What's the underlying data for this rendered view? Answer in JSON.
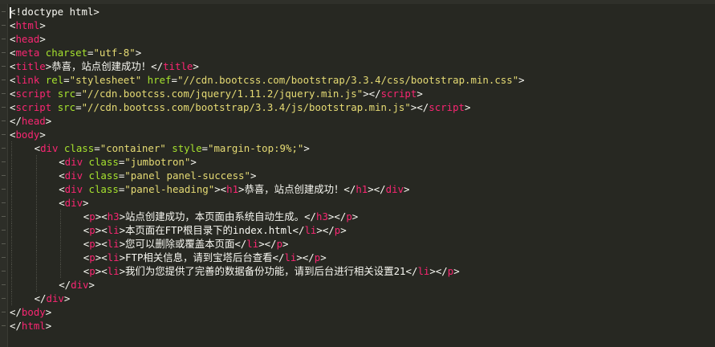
{
  "editor": {
    "background": "#272822",
    "colors": {
      "tag": "#f92672",
      "attribute": "#a6e22e",
      "string": "#e6db74",
      "text": "#f8f8f2"
    },
    "lines": [
      {
        "indent": 0,
        "tokens": [
          [
            "txt",
            "<!doctype html>"
          ]
        ]
      },
      {
        "indent": 0,
        "tokens": [
          [
            "txt",
            "<"
          ],
          [
            "tag",
            "html"
          ],
          [
            "txt",
            ">"
          ]
        ]
      },
      {
        "indent": 0,
        "tokens": [
          [
            "txt",
            "<"
          ],
          [
            "tag",
            "head"
          ],
          [
            "txt",
            ">"
          ]
        ]
      },
      {
        "indent": 0,
        "tokens": [
          [
            "txt",
            "<"
          ],
          [
            "tag",
            "meta"
          ],
          [
            "txt",
            " "
          ],
          [
            "attr",
            "charset"
          ],
          [
            "txt",
            "="
          ],
          [
            "str",
            "\"utf-8\""
          ],
          [
            "txt",
            ">"
          ]
        ]
      },
      {
        "indent": 0,
        "tokens": [
          [
            "txt",
            "<"
          ],
          [
            "tag",
            "title"
          ],
          [
            "txt",
            ">恭喜，站点创建成功！</"
          ],
          [
            "tag",
            "title"
          ],
          [
            "txt",
            ">"
          ]
        ]
      },
      {
        "indent": 0,
        "tokens": [
          [
            "txt",
            "<"
          ],
          [
            "tag",
            "link"
          ],
          [
            "txt",
            " "
          ],
          [
            "attr",
            "rel"
          ],
          [
            "txt",
            "="
          ],
          [
            "str",
            "\"stylesheet\""
          ],
          [
            "txt",
            " "
          ],
          [
            "attr",
            "href"
          ],
          [
            "txt",
            "="
          ],
          [
            "str",
            "\"//cdn.bootcss.com/bootstrap/3.3.4/css/bootstrap.min.css\""
          ],
          [
            "txt",
            ">"
          ]
        ]
      },
      {
        "indent": 0,
        "tokens": [
          [
            "txt",
            "<"
          ],
          [
            "tag",
            "script"
          ],
          [
            "txt",
            " "
          ],
          [
            "attr",
            "src"
          ],
          [
            "txt",
            "="
          ],
          [
            "str",
            "\"//cdn.bootcss.com/jquery/1.11.2/jquery.min.js\""
          ],
          [
            "txt",
            "></"
          ],
          [
            "tag",
            "script"
          ],
          [
            "txt",
            ">"
          ]
        ]
      },
      {
        "indent": 0,
        "tokens": [
          [
            "txt",
            "<"
          ],
          [
            "tag",
            "script"
          ],
          [
            "txt",
            " "
          ],
          [
            "attr",
            "src"
          ],
          [
            "txt",
            "="
          ],
          [
            "str",
            "\"//cdn.bootcss.com/bootstrap/3.3.4/js/bootstrap.min.js\""
          ],
          [
            "txt",
            "></"
          ],
          [
            "tag",
            "script"
          ],
          [
            "txt",
            ">"
          ]
        ]
      },
      {
        "indent": 0,
        "tokens": [
          [
            "txt",
            "</"
          ],
          [
            "tag",
            "head"
          ],
          [
            "txt",
            ">"
          ]
        ]
      },
      {
        "indent": 0,
        "tokens": [
          [
            "txt",
            "<"
          ],
          [
            "tag",
            "body"
          ],
          [
            "txt",
            ">"
          ]
        ]
      },
      {
        "indent": 1,
        "tokens": [
          [
            "txt",
            "<"
          ],
          [
            "tag",
            "div"
          ],
          [
            "txt",
            " "
          ],
          [
            "attr",
            "class"
          ],
          [
            "txt",
            "="
          ],
          [
            "str",
            "\"container\""
          ],
          [
            "txt",
            " "
          ],
          [
            "attr",
            "style"
          ],
          [
            "txt",
            "="
          ],
          [
            "str",
            "\"margin-top:9%;\""
          ],
          [
            "txt",
            ">"
          ]
        ]
      },
      {
        "indent": 2,
        "tokens": [
          [
            "txt",
            "<"
          ],
          [
            "tag",
            "div"
          ],
          [
            "txt",
            " "
          ],
          [
            "attr",
            "class"
          ],
          [
            "txt",
            "="
          ],
          [
            "str",
            "\"jumbotron\""
          ],
          [
            "txt",
            ">"
          ]
        ]
      },
      {
        "indent": 2,
        "tokens": [
          [
            "txt",
            "<"
          ],
          [
            "tag",
            "div"
          ],
          [
            "txt",
            " "
          ],
          [
            "attr",
            "class"
          ],
          [
            "txt",
            "="
          ],
          [
            "str",
            "\"panel panel-success\""
          ],
          [
            "txt",
            ">"
          ]
        ]
      },
      {
        "indent": 2,
        "tokens": [
          [
            "txt",
            "<"
          ],
          [
            "tag",
            "div"
          ],
          [
            "txt",
            " "
          ],
          [
            "attr",
            "class"
          ],
          [
            "txt",
            "="
          ],
          [
            "str",
            "\"panel-heading\""
          ],
          [
            "txt",
            "><"
          ],
          [
            "tag",
            "h1"
          ],
          [
            "txt",
            ">恭喜，站点创建成功！</"
          ],
          [
            "tag",
            "h1"
          ],
          [
            "txt",
            "></"
          ],
          [
            "tag",
            "div"
          ],
          [
            "txt",
            ">"
          ]
        ]
      },
      {
        "indent": 2,
        "tokens": [
          [
            "txt",
            "<"
          ],
          [
            "tag",
            "div"
          ],
          [
            "txt",
            ">"
          ]
        ]
      },
      {
        "indent": 3,
        "tokens": [
          [
            "txt",
            "<"
          ],
          [
            "tag",
            "p"
          ],
          [
            "txt",
            "><"
          ],
          [
            "tag",
            "h3"
          ],
          [
            "txt",
            ">站点创建成功，本页面由系统自动生成。</"
          ],
          [
            "tag",
            "h3"
          ],
          [
            "txt",
            "></"
          ],
          [
            "tag",
            "p"
          ],
          [
            "txt",
            ">"
          ]
        ]
      },
      {
        "indent": 3,
        "tokens": [
          [
            "txt",
            "<"
          ],
          [
            "tag",
            "p"
          ],
          [
            "txt",
            "><"
          ],
          [
            "tag",
            "li"
          ],
          [
            "txt",
            ">本页面在FTP根目录下的index.html</"
          ],
          [
            "tag",
            "li"
          ],
          [
            "txt",
            "></"
          ],
          [
            "tag",
            "p"
          ],
          [
            "txt",
            ">"
          ]
        ]
      },
      {
        "indent": 3,
        "tokens": [
          [
            "txt",
            "<"
          ],
          [
            "tag",
            "p"
          ],
          [
            "txt",
            "><"
          ],
          [
            "tag",
            "li"
          ],
          [
            "txt",
            ">您可以删除或覆盖本页面</"
          ],
          [
            "tag",
            "li"
          ],
          [
            "txt",
            "></"
          ],
          [
            "tag",
            "p"
          ],
          [
            "txt",
            ">"
          ]
        ]
      },
      {
        "indent": 3,
        "tokens": [
          [
            "txt",
            "<"
          ],
          [
            "tag",
            "p"
          ],
          [
            "txt",
            "><"
          ],
          [
            "tag",
            "li"
          ],
          [
            "txt",
            ">FTP相关信息，请到宝塔后台查看</"
          ],
          [
            "tag",
            "li"
          ],
          [
            "txt",
            "></"
          ],
          [
            "tag",
            "p"
          ],
          [
            "txt",
            ">"
          ]
        ]
      },
      {
        "indent": 3,
        "tokens": [
          [
            "txt",
            "<"
          ],
          [
            "tag",
            "p"
          ],
          [
            "txt",
            "><"
          ],
          [
            "tag",
            "li"
          ],
          [
            "txt",
            ">我们为您提供了完善的数据备份功能，请到后台进行相关设置21</"
          ],
          [
            "tag",
            "li"
          ],
          [
            "txt",
            "></"
          ],
          [
            "tag",
            "p"
          ],
          [
            "txt",
            ">"
          ]
        ]
      },
      {
        "indent": 2,
        "tokens": [
          [
            "txt",
            "</"
          ],
          [
            "tag",
            "div"
          ],
          [
            "txt",
            ">"
          ]
        ]
      },
      {
        "indent": 1,
        "tokens": [
          [
            "txt",
            "</"
          ],
          [
            "tag",
            "div"
          ],
          [
            "txt",
            ">"
          ]
        ]
      },
      {
        "indent": 0,
        "tokens": [
          [
            "txt",
            "</"
          ],
          [
            "tag",
            "body"
          ],
          [
            "txt",
            ">"
          ]
        ]
      },
      {
        "indent": 0,
        "tokens": [
          [
            "txt",
            "</"
          ],
          [
            "tag",
            "html"
          ],
          [
            "txt",
            ">"
          ]
        ]
      }
    ]
  }
}
